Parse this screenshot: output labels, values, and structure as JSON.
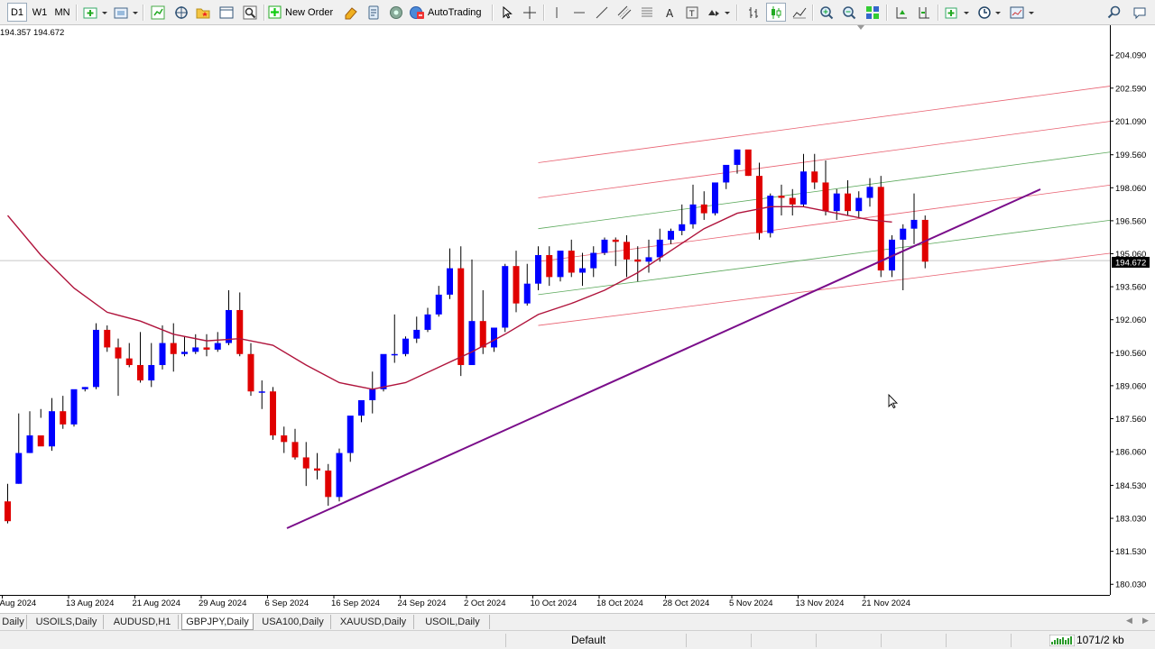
{
  "toolbar": {
    "period_buttons": [
      "D1",
      "W1",
      "MN"
    ],
    "new_order_label": "New Order",
    "autotrading_label": "AutoTrading"
  },
  "chart": {
    "ohlc_readout": "194.357 194.672",
    "current_price_label": "194.672",
    "colors": {
      "bull": "#0000ff",
      "bear": "#e00000",
      "ma": "#b0143c",
      "trendline": "#7a0d8a",
      "channel_red": "#e86070",
      "channel_green": "#5aa85a"
    }
  },
  "chart_data": {
    "type": "candlestick",
    "symbol": "GBPJPY",
    "timeframe": "Daily",
    "price_axis_ticks": [
      "204.090",
      "202.590",
      "201.090",
      "199.560",
      "198.060",
      "196.560",
      "195.060",
      "193.560",
      "192.060",
      "190.560",
      "189.060",
      "187.560",
      "186.060",
      "184.530",
      "183.030",
      "181.530",
      "180.030"
    ],
    "price_axis_values": [
      204.09,
      202.59,
      201.09,
      199.56,
      198.06,
      196.56,
      195.06,
      193.56,
      192.06,
      190.56,
      189.06,
      187.56,
      186.06,
      184.53,
      183.03,
      181.53,
      180.03
    ],
    "time_axis_labels": [
      "Aug 2024",
      "13 Aug 2024",
      "21 Aug 2024",
      "29 Aug 2024",
      "6 Sep 2024",
      "16 Sep 2024",
      "24 Sep 2024",
      "2 Oct 2024",
      "10 Oct 2024",
      "18 Oct 2024",
      "28 Oct 2024",
      "5 Nov 2024",
      "13 Nov 2024",
      "21 Nov 2024"
    ],
    "time_axis_label_index": [
      0,
      6,
      12,
      18,
      24,
      30,
      36,
      42,
      48,
      54,
      60,
      66,
      72,
      78
    ],
    "candles": [
      [
        183.8,
        184.6,
        182.9,
        182.8
      ],
      [
        184.6,
        187.8,
        186.0,
        184.6
      ],
      [
        186.0,
        187.9,
        186.8,
        186.0
      ],
      [
        186.8,
        188.0,
        186.3,
        187.6
      ],
      [
        186.3,
        188.5,
        187.9,
        186.1
      ],
      [
        187.9,
        188.6,
        187.3,
        187.1
      ],
      [
        187.3,
        188.7,
        188.9,
        187.2
      ],
      [
        188.9,
        189.0,
        189.0,
        188.8
      ],
      [
        189.0,
        191.9,
        191.6,
        188.9
      ],
      [
        191.6,
        191.8,
        190.8,
        190.6
      ],
      [
        190.8,
        191.2,
        190.3,
        188.6
      ],
      [
        190.3,
        191.0,
        190.0,
        189.9
      ],
      [
        190.0,
        191.5,
        189.3,
        189.2
      ],
      [
        189.3,
        191.0,
        190.0,
        189.0
      ],
      [
        190.0,
        191.8,
        191.0,
        189.8
      ],
      [
        191.0,
        191.9,
        190.5,
        189.7
      ],
      [
        190.5,
        191.3,
        190.6,
        190.4
      ],
      [
        190.6,
        191.4,
        190.8,
        190.5
      ],
      [
        190.8,
        191.4,
        190.7,
        190.4
      ],
      [
        190.7,
        191.5,
        191.0,
        190.6
      ],
      [
        191.0,
        193.4,
        192.5,
        190.9
      ],
      [
        192.5,
        193.3,
        190.5,
        190.4
      ],
      [
        190.5,
        191.0,
        188.8,
        188.6
      ],
      [
        188.8,
        189.3,
        188.8,
        188.0
      ],
      [
        188.8,
        189.0,
        186.8,
        186.6
      ],
      [
        186.8,
        187.2,
        186.5,
        186.0
      ],
      [
        186.5,
        187.1,
        185.8,
        185.7
      ],
      [
        185.8,
        186.5,
        185.3,
        184.5
      ],
      [
        185.3,
        186.0,
        185.2,
        184.8
      ],
      [
        185.2,
        185.5,
        184.0,
        183.6
      ],
      [
        184.0,
        186.2,
        186.0,
        183.8
      ],
      [
        186.0,
        187.6,
        187.7,
        185.6
      ],
      [
        187.7,
        188.3,
        188.4,
        187.4
      ],
      [
        188.4,
        189.7,
        188.9,
        187.8
      ],
      [
        188.9,
        189.8,
        190.5,
        188.8
      ],
      [
        190.5,
        192.3,
        190.5,
        190.1
      ],
      [
        190.5,
        191.3,
        191.2,
        190.4
      ],
      [
        191.2,
        192.2,
        191.6,
        191.0
      ],
      [
        191.6,
        192.6,
        192.3,
        191.5
      ],
      [
        192.3,
        193.6,
        193.2,
        192.2
      ],
      [
        193.2,
        195.3,
        194.4,
        193.0
      ],
      [
        194.4,
        195.4,
        190.0,
        189.5
      ],
      [
        190.0,
        194.8,
        192.0,
        190.0
      ],
      [
        192.0,
        193.4,
        190.8,
        190.5
      ],
      [
        190.8,
        191.2,
        191.7,
        190.6
      ],
      [
        191.7,
        194.6,
        194.5,
        191.5
      ],
      [
        194.5,
        195.2,
        192.8,
        192.4
      ],
      [
        192.8,
        194.6,
        193.7,
        192.7
      ],
      [
        193.7,
        195.4,
        195.0,
        193.4
      ],
      [
        195.0,
        195.4,
        194.0,
        193.6
      ],
      [
        194.0,
        195.1,
        195.2,
        193.8
      ],
      [
        195.2,
        195.7,
        194.2,
        194.0
      ],
      [
        194.2,
        195.1,
        194.4,
        193.6
      ],
      [
        194.4,
        195.4,
        195.1,
        194.0
      ],
      [
        195.1,
        195.8,
        195.7,
        195.0
      ],
      [
        195.7,
        195.8,
        195.6,
        194.5
      ],
      [
        195.6,
        195.9,
        194.8,
        194.0
      ],
      [
        194.8,
        195.4,
        194.7,
        193.8
      ],
      [
        194.7,
        195.7,
        194.9,
        194.2
      ],
      [
        194.9,
        196.2,
        195.7,
        194.7
      ],
      [
        195.7,
        196.2,
        196.1,
        195.5
      ],
      [
        196.1,
        197.3,
        196.4,
        195.9
      ],
      [
        196.4,
        198.2,
        197.3,
        196.2
      ],
      [
        197.3,
        197.9,
        196.9,
        196.6
      ],
      [
        196.9,
        198.0,
        198.3,
        196.8
      ],
      [
        198.3,
        198.8,
        199.1,
        198.0
      ],
      [
        199.1,
        199.8,
        199.8,
        198.7
      ],
      [
        199.8,
        199.7,
        198.6,
        198.6
      ],
      [
        198.6,
        199.2,
        196.0,
        195.7
      ],
      [
        196.0,
        197.8,
        197.7,
        195.8
      ],
      [
        197.7,
        198.2,
        197.6,
        196.8
      ],
      [
        197.6,
        198.0,
        197.3,
        196.8
      ],
      [
        197.3,
        199.6,
        198.8,
        197.2
      ],
      [
        198.8,
        199.6,
        198.3,
        198.0
      ],
      [
        198.3,
        199.3,
        197.0,
        196.8
      ],
      [
        197.0,
        198.0,
        197.8,
        196.6
      ],
      [
        197.8,
        198.4,
        197.0,
        196.8
      ],
      [
        197.0,
        197.9,
        197.6,
        196.7
      ],
      [
        197.6,
        198.5,
        198.1,
        197.2
      ],
      [
        198.1,
        198.6,
        194.3,
        194.0
      ],
      [
        194.3,
        195.9,
        195.7,
        194.0
      ],
      [
        195.7,
        196.4,
        196.2,
        193.4
      ],
      [
        196.2,
        197.8,
        196.6,
        195.5
      ],
      [
        196.6,
        196.8,
        194.7,
        194.4
      ]
    ],
    "moving_average": [
      [
        0,
        196.8
      ],
      [
        3,
        195.0
      ],
      [
        6,
        193.5
      ],
      [
        9,
        192.4
      ],
      [
        12,
        192.0
      ],
      [
        15,
        191.4
      ],
      [
        18,
        191.1
      ],
      [
        21,
        191.2
      ],
      [
        24,
        190.9
      ],
      [
        27,
        190.0
      ],
      [
        30,
        189.2
      ],
      [
        33,
        188.9
      ],
      [
        36,
        189.2
      ],
      [
        39,
        189.9
      ],
      [
        42,
        190.6
      ],
      [
        45,
        191.4
      ],
      [
        48,
        192.3
      ],
      [
        51,
        192.8
      ],
      [
        54,
        193.4
      ],
      [
        57,
        194.2
      ],
      [
        60,
        195.2
      ],
      [
        63,
        196.2
      ],
      [
        66,
        196.9
      ],
      [
        69,
        197.2
      ],
      [
        72,
        197.2
      ],
      [
        75,
        196.9
      ],
      [
        78,
        196.6
      ],
      [
        80,
        196.5
      ]
    ],
    "ylim": [
      180.03,
      204.09
    ]
  },
  "tabs": [
    {
      "label": "Daily"
    },
    {
      "label": "USOILS,Daily"
    },
    {
      "label": "AUDUSD,H1"
    },
    {
      "label": "GBPJPY,Daily"
    },
    {
      "label": "USA100,Daily"
    },
    {
      "label": "XAUUSD,Daily"
    },
    {
      "label": "USOIL,Daily"
    }
  ],
  "status": {
    "profile": "Default",
    "traffic": "1071/2 kb"
  }
}
